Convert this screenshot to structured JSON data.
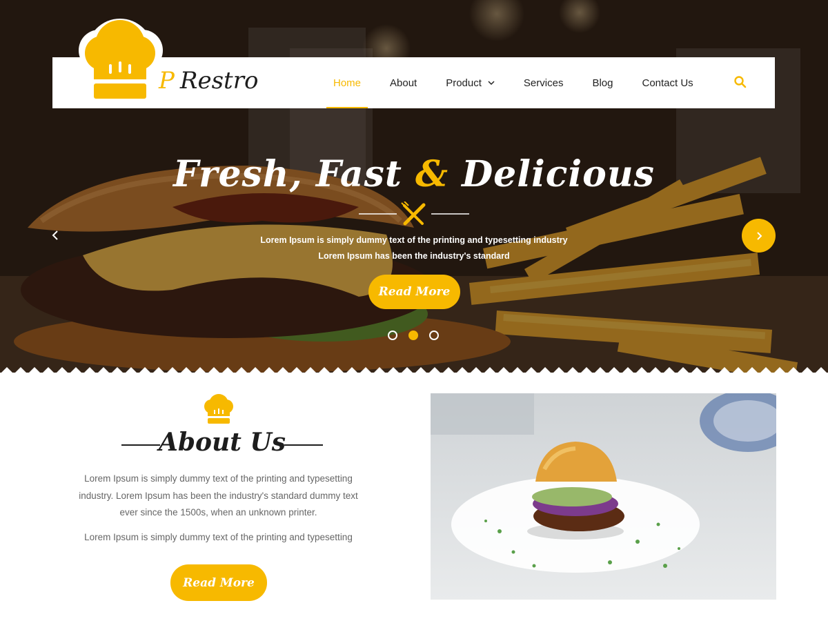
{
  "brand": {
    "name_prefix": "P",
    "name": "Restro"
  },
  "nav": {
    "items": [
      {
        "label": "Home",
        "active": true
      },
      {
        "label": "About"
      },
      {
        "label": "Product",
        "dropdown": true
      },
      {
        "label": "Services"
      },
      {
        "label": "Blog"
      },
      {
        "label": "Contact Us"
      }
    ],
    "search_icon": "search-icon"
  },
  "hero": {
    "title_part1": "Fresh, Fast",
    "title_amp": "&",
    "title_part2": "Delicious",
    "subtitle_line1": "Lorem Ipsum is simply dummy text of the printing and typesetting industry",
    "subtitle_line2": "Lorem Ipsum has been the industry's standard",
    "button_label": "Read More",
    "slides": 3,
    "active_slide": 2
  },
  "about": {
    "title": "About Us",
    "paragraph1": "Lorem Ipsum is simply dummy text of the printing and typesetting industry. Lorem Ipsum has been the industry's standard dummy text ever since the 1500s, when an unknown printer.",
    "paragraph2": "Lorem Ipsum is simply dummy text of the printing and typesetting",
    "button_label": "Read More"
  },
  "colors": {
    "accent": "#f7b900",
    "dark": "#1d1d1d",
    "text_muted": "#666666"
  }
}
